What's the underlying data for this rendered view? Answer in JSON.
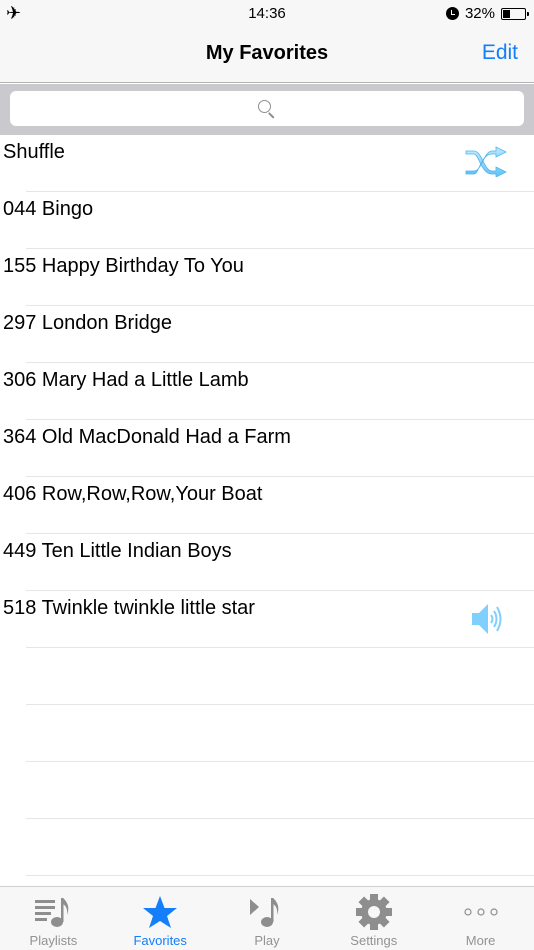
{
  "status_bar": {
    "airplane_icon": "airplane-icon",
    "time": "14:36",
    "alarm_icon": "alarm-icon",
    "battery_percent": "32%",
    "battery_level": 0.32
  },
  "nav": {
    "title": "My Favorites",
    "edit_label": "Edit"
  },
  "search": {
    "placeholder": "",
    "icon": "search-icon"
  },
  "list": {
    "items": [
      {
        "label": "Shuffle",
        "icon": "shuffle-icon"
      },
      {
        "label": "044 Bingo"
      },
      {
        "label": "155 Happy Birthday To You"
      },
      {
        "label": "297 London Bridge"
      },
      {
        "label": "306 Mary Had a Little Lamb"
      },
      {
        "label": "364 Old MacDonald Had a Farm"
      },
      {
        "label": "406 Row,Row,Row,Your Boat"
      },
      {
        "label": "449 Ten Little Indian Boys"
      },
      {
        "label": "518 Twinkle twinkle little star",
        "icon": "speaker-icon",
        "now_playing": true
      }
    ]
  },
  "colors": {
    "accent": "#157efb",
    "inactive_tab": "#929292",
    "icon_light_blue": "#7fd0ff"
  },
  "tabs": [
    {
      "label": "Playlists",
      "icon": "playlist-icon",
      "active": false
    },
    {
      "label": "Favorites",
      "icon": "star-icon",
      "active": true
    },
    {
      "label": "Play",
      "icon": "play-note-icon",
      "active": false
    },
    {
      "label": "Settings",
      "icon": "gear-icon",
      "active": false
    },
    {
      "label": "More",
      "icon": "more-icon",
      "active": false
    }
  ]
}
